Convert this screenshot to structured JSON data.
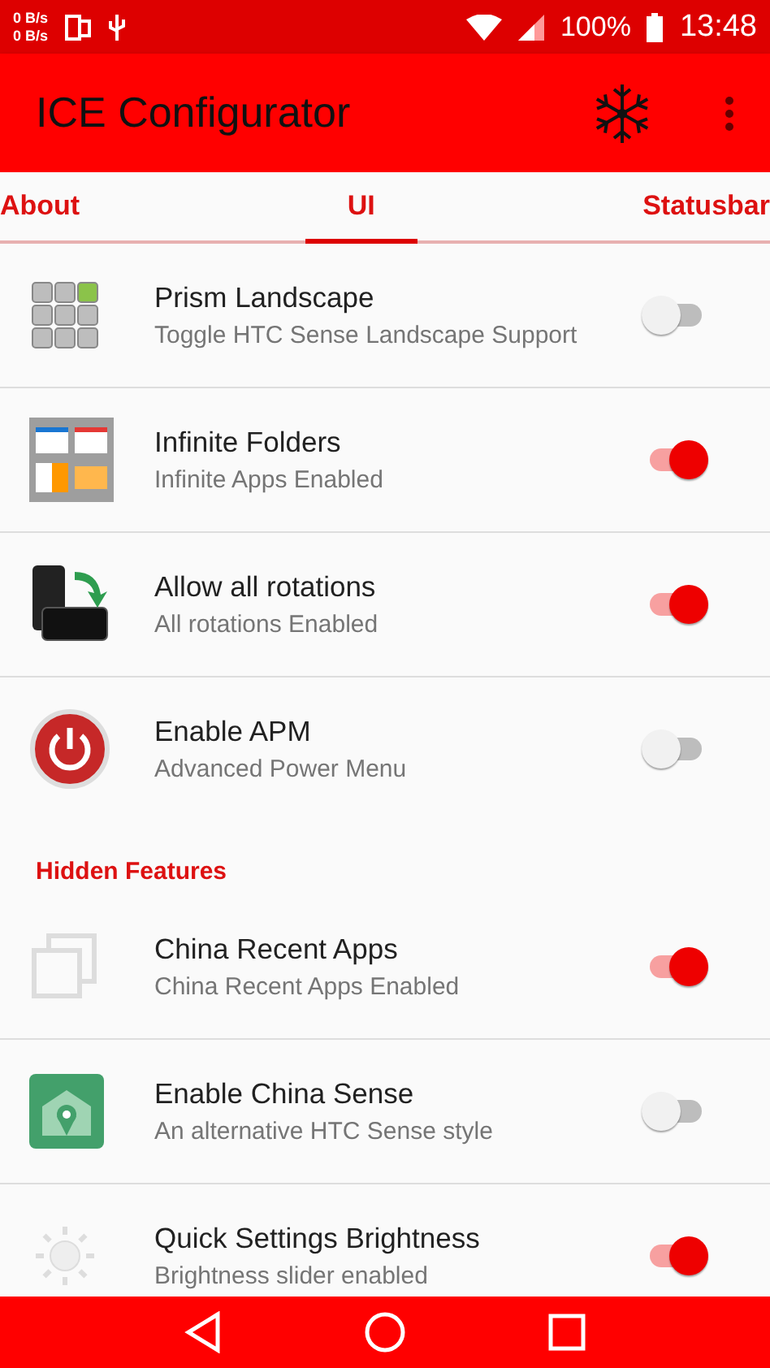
{
  "status_bar": {
    "speed_up": "0 B/s",
    "speed_down": "0 B/s",
    "battery": "100%",
    "time": "13:48"
  },
  "app_bar": {
    "title": "ICE Configurator"
  },
  "tabs": [
    {
      "label": "About",
      "selected": false
    },
    {
      "label": "UI",
      "selected": true
    },
    {
      "label": "Statusbar",
      "selected": false
    }
  ],
  "sections": [
    {
      "items": [
        {
          "title": "Prism Landscape",
          "summary": "Toggle HTC Sense Landscape Support",
          "on": false
        },
        {
          "title": "Infinite Folders",
          "summary": "Infinite Apps Enabled",
          "on": true
        },
        {
          "title": "Allow all rotations",
          "summary": "All rotations Enabled",
          "on": true
        },
        {
          "title": "Enable APM",
          "summary": "Advanced Power Menu",
          "on": false
        }
      ]
    },
    {
      "header": "Hidden Features",
      "items": [
        {
          "title": "China Recent Apps",
          "summary": "China Recent Apps Enabled",
          "on": true
        },
        {
          "title": "Enable China Sense",
          "summary": "An alternative HTC Sense style",
          "on": false
        },
        {
          "title": "Quick Settings Brightness",
          "summary": "Brightness slider enabled",
          "on": true
        }
      ]
    }
  ]
}
